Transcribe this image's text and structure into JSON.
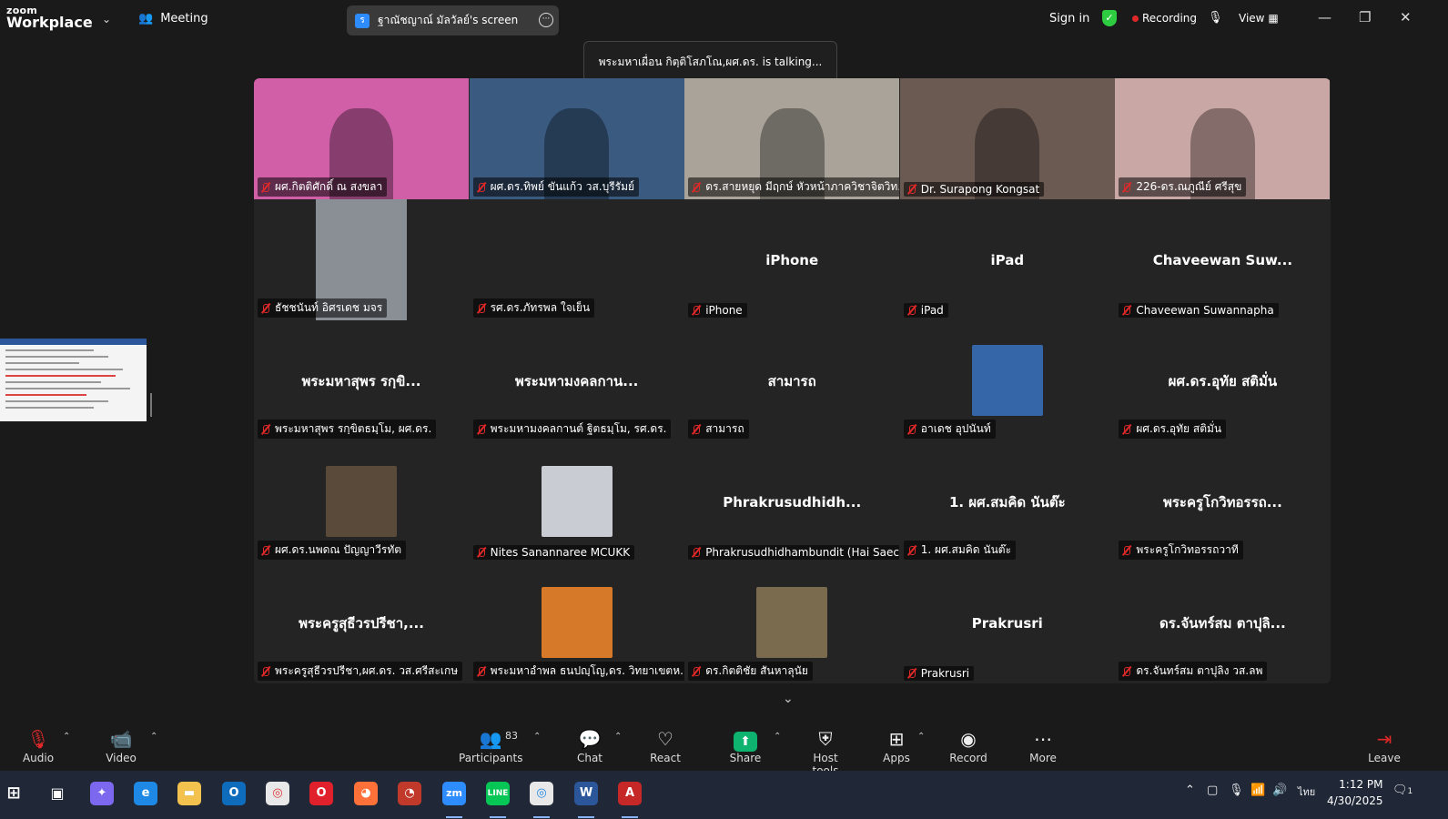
{
  "app": {
    "logo_top": "zoom",
    "logo_bottom": "Workplace"
  },
  "header": {
    "meeting_label": "Meeting",
    "share_title": "ฐาณัชญาณ์ มัลวัลย์'s screen",
    "signin": "Sign in",
    "recording": "Recording",
    "view": "View"
  },
  "talking_banner": "พระมหาเผื่อน กิตฺติโสภโณ,ผศ.ดร. is talking...",
  "tiles": [
    {
      "label": "ผศ.กิตติศักดิ์ ณ สงขลา",
      "big": "",
      "kind": "video",
      "color": "#d05fa8"
    },
    {
      "label": "ผศ.ดร.ทิพย์ ขันแก้ว วส.บุรีรัมย์",
      "big": "",
      "kind": "video",
      "color": "#3a5a80"
    },
    {
      "label": "ดร.สายหยุด มีฤกษ์ หัวหน้าภาควิชาจิตวิท...",
      "big": "",
      "kind": "video",
      "color": "#a9a39a"
    },
    {
      "label": "Dr. Surapong Kongsat",
      "big": "",
      "kind": "video",
      "color": "#6b5a52"
    },
    {
      "label": "226-ดร.ณภูณีย์ ศรีสุข",
      "big": "",
      "kind": "video",
      "color": "#c9a7a4"
    },
    {
      "label": "ธัชชนันท์ อิศรเดช มจร",
      "big": "",
      "kind": "avatar-lg",
      "color": "#8a8f96"
    },
    {
      "label": "รศ.ดร.ภัทรพล ใจเย็น",
      "big": "",
      "kind": "blank",
      "color": ""
    },
    {
      "label": "iPhone",
      "big": "iPhone",
      "kind": "name",
      "color": ""
    },
    {
      "label": "iPad",
      "big": "iPad",
      "kind": "name",
      "color": ""
    },
    {
      "label": "Chaveewan Suwannapha",
      "big": "Chaveewan Suw...",
      "kind": "name",
      "color": ""
    },
    {
      "label": "พระมหาสุพร รกฺขิตธมฺโม, ผศ.ดร.",
      "big": "พระมหาสุพร รกฺขิ...",
      "kind": "name",
      "color": ""
    },
    {
      "label": "พระมหามงคลกานต์ ฐิตธมฺโม, รศ.ดร.",
      "big": "พระมหามงคลกาน...",
      "kind": "name",
      "color": ""
    },
    {
      "label": "สามารถ",
      "big": "สามารถ",
      "kind": "name",
      "color": ""
    },
    {
      "label": "อาเดช อุปนันท์",
      "big": "",
      "kind": "avatar",
      "color": "#3566a8"
    },
    {
      "label": "ผศ.ดร.อุทัย สติมั่น",
      "big": "ผศ.ดร.อุทัย สติมั่น",
      "kind": "name",
      "color": ""
    },
    {
      "label": "ผศ.ดร.นพดณ ปัญญาวีรทัต",
      "big": "",
      "kind": "avatar",
      "color": "#5a4a3a"
    },
    {
      "label": "Nites Sanannaree MCUKK",
      "big": "",
      "kind": "avatar",
      "color": "#c9ccd2"
    },
    {
      "label": "Phrakrusudhidhambundit (Hai Saec...",
      "big": "Phrakrusudhidh...",
      "kind": "name",
      "color": ""
    },
    {
      "label": "1. ผศ.สมคิด นันต๊ะ",
      "big": "1. ผศ.สมคิด นันต๊ะ",
      "kind": "name",
      "color": ""
    },
    {
      "label": "พระครูโกวิทอรรถวาที",
      "big": "พระครูโกวิทอรรถ...",
      "kind": "name",
      "color": ""
    },
    {
      "label": "พระครูสุธีวรปรีชา,ผศ.ดร. วส.ศรีสะเกษ",
      "big": "พระครูสุธีวรปรีชา,...",
      "kind": "name",
      "color": ""
    },
    {
      "label": "พระมหาอำพล ธนปญฺโญ,ดร. วิทยาเขตห...",
      "big": "",
      "kind": "avatar",
      "color": "#d67a2a"
    },
    {
      "label": "ดร.กิตติชัย สันหาลุนัย",
      "big": "",
      "kind": "avatar",
      "color": "#7a6a4e"
    },
    {
      "label": "Prakrusri",
      "big": "Prakrusri",
      "kind": "name",
      "color": ""
    },
    {
      "label": "ดร.จันทร์สม ตาปุลิง วส.ลพ",
      "big": "ดร.จันทร์สม ตาปุลิ...",
      "kind": "name",
      "color": ""
    }
  ],
  "toolbar": {
    "audio": "Audio",
    "video": "Video",
    "participants": "Participants",
    "participants_count": "83",
    "chat": "Chat",
    "react": "React",
    "share": "Share",
    "host_tools": "Host tools",
    "apps": "Apps",
    "record": "Record",
    "more": "More",
    "leave": "Leave"
  },
  "taskbar": {
    "lang": "ไทย",
    "time": "1:12 PM",
    "date": "4/30/2025",
    "notif_count": "1"
  }
}
